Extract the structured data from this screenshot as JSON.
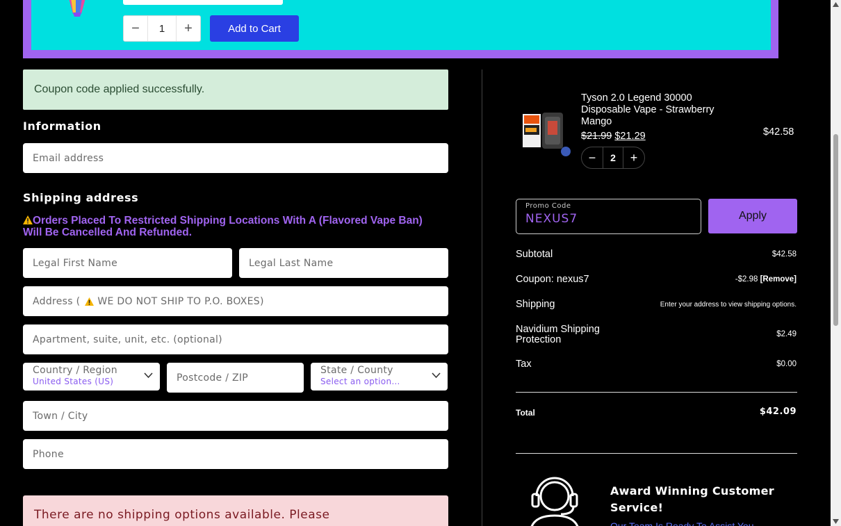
{
  "upsell": {
    "quantity": "1",
    "add_to_cart_label": "Add to Cart"
  },
  "notices": {
    "coupon_applied": "Coupon code applied successfully.",
    "no_shipping": "There are no shipping options available. Please"
  },
  "information": {
    "title": "Information",
    "email_placeholder": "Email address"
  },
  "shipping": {
    "title": "Shipping address",
    "warning": "Orders Placed To Restricted Shipping Locations With A (Flavored Vape Ban) Will Be Cancelled And Refunded.",
    "first_name_placeholder": "Legal First Name",
    "last_name_placeholder": "Legal Last Name",
    "address_placeholder_prefix": "Address (",
    "address_placeholder_suffix": "WE DO NOT SHIP TO P.O. BOXES)",
    "apartment_placeholder": "Apartment, suite, unit, etc. (optional)",
    "country_label": "Country / Region",
    "country_value": "United States (US)",
    "postcode_placeholder": "Postcode / ZIP",
    "state_label": "State / County",
    "state_value": "Select an option…",
    "city_placeholder": "Town / City",
    "phone_placeholder": "Phone"
  },
  "cart_item": {
    "name": "Tyson 2.0 Legend 30000 Disposable Vape - Strawberry Mango",
    "old_price": "$21.99",
    "new_price": "$21.29",
    "line_total": "$42.58",
    "quantity": "2"
  },
  "promo": {
    "label": "Promo Code",
    "value": "NEXUS7",
    "apply_label": "Apply"
  },
  "summary": {
    "subtotal_label": "Subtotal",
    "subtotal_value": "$42.58",
    "coupon_label": "Coupon: nexus7",
    "coupon_value": "-$2.98",
    "coupon_remove": "[Remove]",
    "shipping_label": "Shipping",
    "shipping_value": "Enter your address to view shipping options.",
    "protection_label": "Navidium Shipping Protection",
    "protection_value": "$2.49",
    "tax_label": "Tax",
    "tax_value": "$0.00",
    "total_label": "Total",
    "total_value": "$42.09"
  },
  "support": {
    "title": "Award Winning Customer Service!",
    "link": "Our Team Is Ready To Assist You"
  },
  "colors": {
    "accent_purple": "#a064f0",
    "banner_cyan": "#00e0e0",
    "button_blue": "#2a3fe3",
    "success_bg": "#d4edda",
    "error_bg": "#f8d7da"
  }
}
